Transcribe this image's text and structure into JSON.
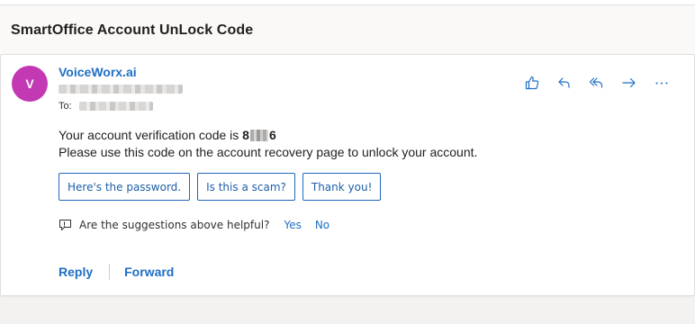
{
  "email": {
    "subject": "SmartOffice Account UnLock Code",
    "sender": {
      "initial": "V",
      "name": "VoiceWorx.ai",
      "avatar_color": "#c239b3"
    },
    "to_label": "To:",
    "body": {
      "line1_prefix": "Your account verification code is ",
      "code_start": "8",
      "code_end": "6",
      "line2": "Please use this code on the account recovery page to unlock your account."
    },
    "actions": [
      {
        "name": "like-icon"
      },
      {
        "name": "reply-icon"
      },
      {
        "name": "reply-all-icon"
      },
      {
        "name": "forward-icon"
      },
      {
        "name": "more-icon"
      }
    ],
    "suggested_replies": [
      "Here's the password.",
      "Is this a scam?",
      "Thank you!"
    ],
    "feedback": {
      "question": "Are the suggestions above helpful?",
      "yes": "Yes",
      "no": "No"
    },
    "reply_label": "Reply",
    "forward_label": "Forward"
  },
  "colors": {
    "accent": "#1f6fc5",
    "avatar": "#c239b3"
  }
}
